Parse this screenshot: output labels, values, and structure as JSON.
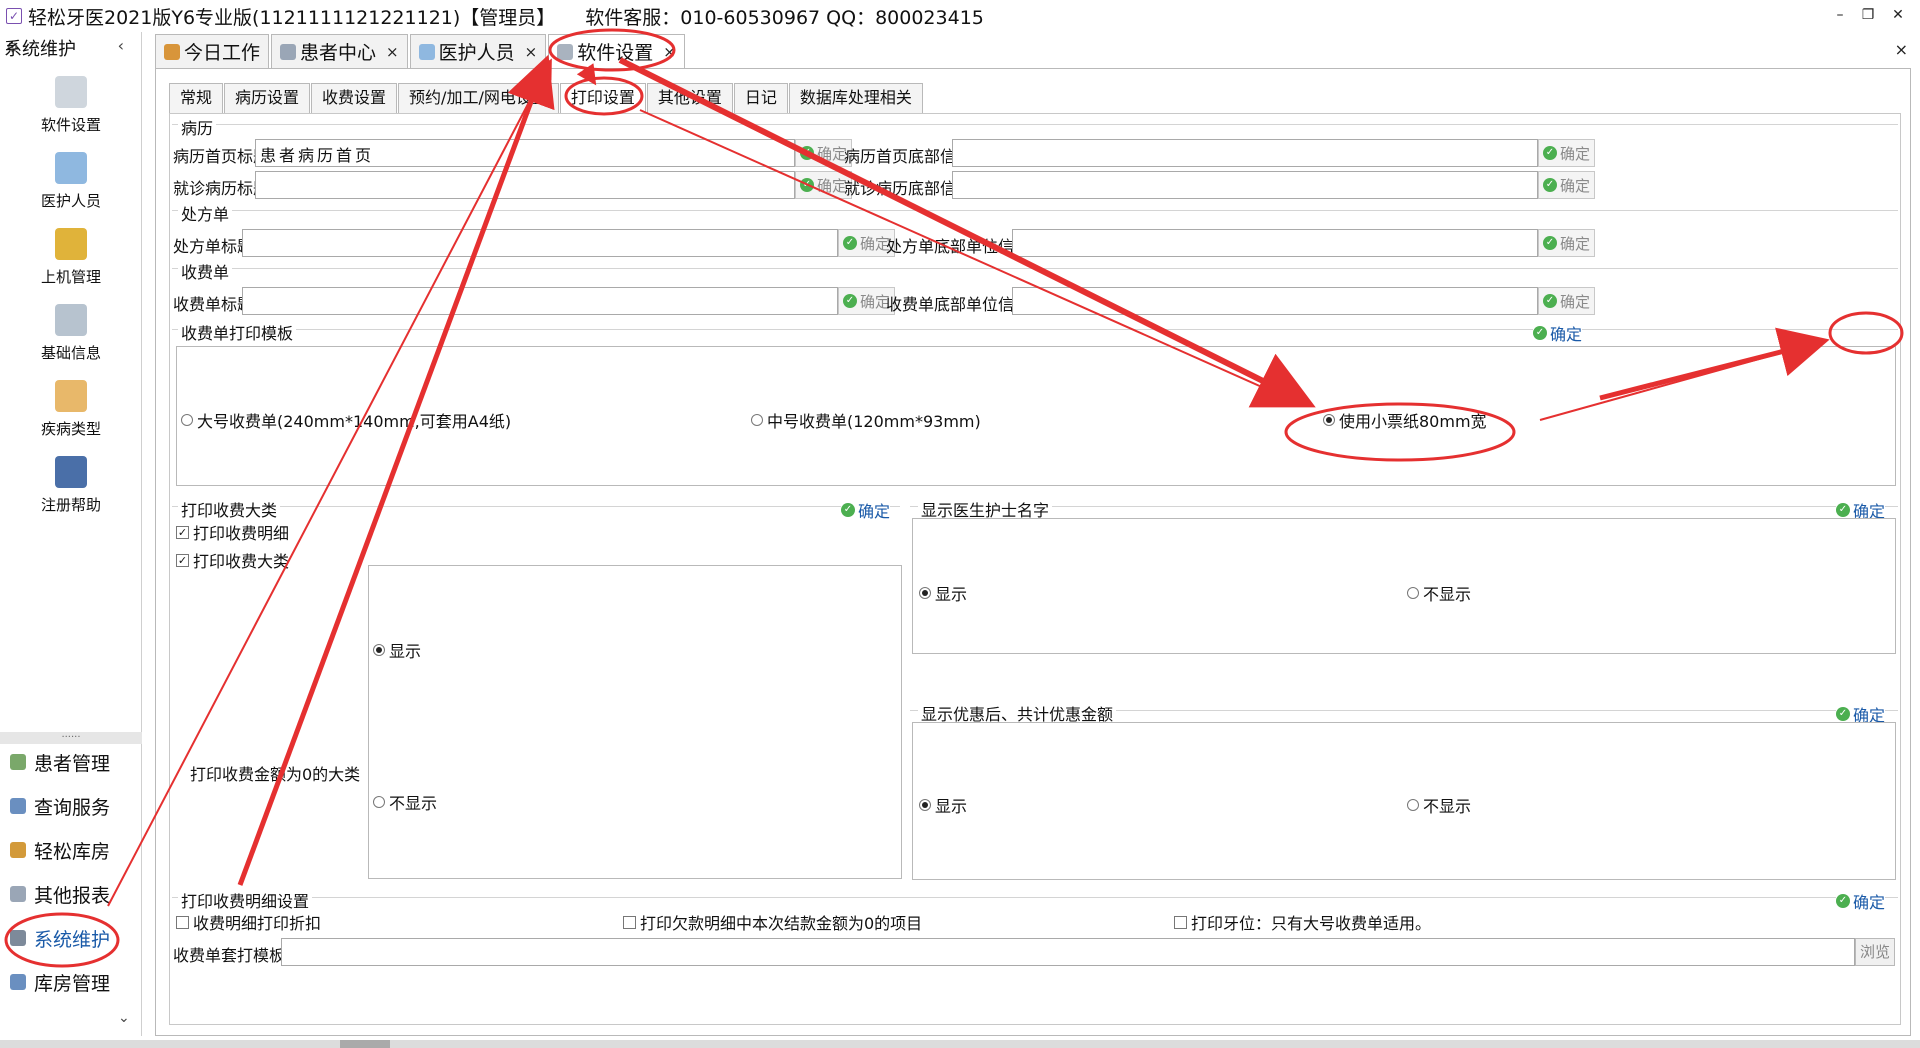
{
  "window": {
    "title": "轻松牙医2021版Y6专业版(1121111121221121)【管理员】",
    "support": "软件客服：010-60530967 QQ：800023415",
    "minimize": "–",
    "restore": "❐",
    "close": "✕"
  },
  "sidebar": {
    "header": "系统维护",
    "collapse": "‹",
    "big_items": [
      {
        "label": "软件设置",
        "icon": "gears-icon"
      },
      {
        "label": "医护人员",
        "icon": "staff-icon"
      },
      {
        "label": "上机管理",
        "icon": "lock-icon"
      },
      {
        "label": "基础信息",
        "icon": "info-gear-icon"
      },
      {
        "label": "疾病类型",
        "icon": "tree-icon"
      },
      {
        "label": "注册帮助",
        "icon": "help-icon"
      }
    ],
    "divider": "......",
    "nav_items": [
      {
        "label": "患者管理"
      },
      {
        "label": "查询服务"
      },
      {
        "label": "轻松库房"
      },
      {
        "label": "其他报表"
      },
      {
        "label": "系统维护"
      },
      {
        "label": "库房管理"
      }
    ],
    "more": "⌄"
  },
  "main_tabs": [
    {
      "label": "今日工作",
      "close": ""
    },
    {
      "label": "患者中心",
      "close": "×"
    },
    {
      "label": "医护人员",
      "close": "×"
    },
    {
      "label": "软件设置",
      "close": "×"
    }
  ],
  "main_close": "×",
  "sub_tabs": [
    "常规",
    "病历设置",
    "收费设置",
    "预约/加工/网电设置",
    "打印设置",
    "其他设置",
    "日记",
    "数据库处理相关"
  ],
  "ok_label": "确定",
  "medical_record": {
    "section": "病历",
    "home_title_label": "病历首页标题",
    "home_title_value": "患者病历首页",
    "home_footer_label": "病历首页底部信息",
    "home_footer_value": "",
    "visit_title_label": "就诊病历标题",
    "visit_title_value": "",
    "visit_footer_label": "就诊病历底部信息",
    "visit_footer_value": ""
  },
  "prescription": {
    "section": "处方单",
    "title_label": "处方单标题",
    "title_value": "",
    "footer_label": "处方单底部单位信息",
    "footer_value": ""
  },
  "receipt": {
    "section": "收费单",
    "title_label": "收费单标题",
    "title_value": "",
    "footer_label": "收费单底部单位信息",
    "footer_value": ""
  },
  "template": {
    "section": "收费单打印模板",
    "options": [
      "大号收费单(240mm*140mm,可套用A4纸)",
      "中号收费单(120mm*93mm)",
      "使用小票纸80mm宽"
    ],
    "selected": 2
  },
  "print_category": {
    "section": "打印收费大类",
    "detail": "打印收费明细",
    "category": "打印收费大类",
    "zero_label": "打印收费金额为0的大类",
    "show": "显示",
    "hide": "不显示"
  },
  "doctor_name": {
    "section": "显示医生护士名字",
    "show": "显示",
    "hide": "不显示"
  },
  "discount": {
    "section": "显示优惠后、共计优惠金额",
    "show": "显示",
    "hide": "不显示"
  },
  "detail_settings": {
    "section": "打印收费明细设置",
    "opt1": "收费明细打印折扣",
    "opt2": "打印欠款明细中本次结款金额为0的项目",
    "opt3": "打印牙位：只有大号收费单适用。"
  },
  "receipt_template": {
    "label": "收费单套打模板",
    "value": "",
    "browse": "浏览"
  },
  "check_mark": "✓"
}
